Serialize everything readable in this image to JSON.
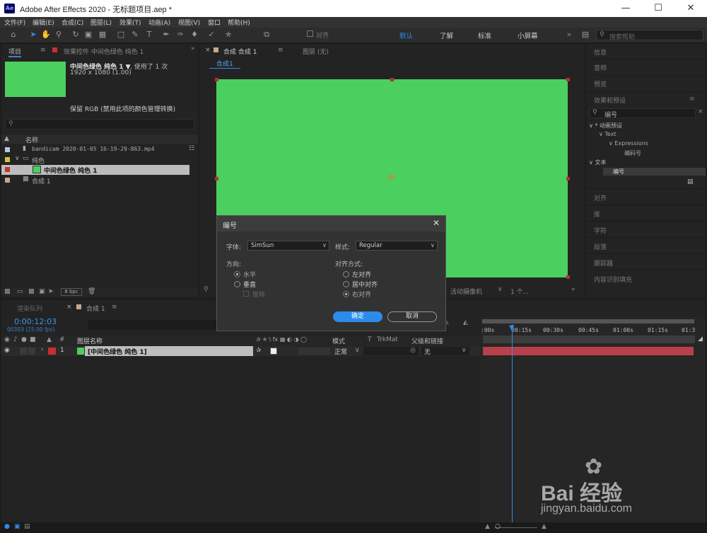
{
  "titlebar": {
    "icon": "Ae",
    "title": "Adobe After Effects 2020 - 无标题项目.aep *"
  },
  "menu": [
    "文件(F)",
    "编辑(E)",
    "合成(C)",
    "图层(L)",
    "效果(T)",
    "动画(A)",
    "视图(V)",
    "窗口",
    "帮助(H)"
  ],
  "toolbar": {
    "align_label": "对齐",
    "workspaces": [
      "默认",
      "了解",
      "标准",
      "小屏幕"
    ],
    "search_placeholder": "搜索帮助"
  },
  "project_panel": {
    "tab_project": "项目",
    "tab_effects": "效果控件 中间色绿色 纯色 1",
    "thumb_name": "中间色绿色 纯色 1 ▼",
    "used_times": ", 使用了 1 次",
    "dims": "1920 x 1080 (1.00)",
    "color_note": "保留 RGB (禁用此项的颜色管理转换)",
    "col_name": "名称",
    "items": [
      {
        "name": "bandicam 2020-01-05 16-19-29-863.mp4",
        "label_color": "#b4c8dc"
      },
      {
        "name": "纯色",
        "label_color": "#d8c038"
      },
      {
        "name": "中间色绿色 纯色 1",
        "label_color": "#c83030"
      },
      {
        "name": "合成 1",
        "label_color": "#c8a888"
      }
    ],
    "bpc": "8 bpc"
  },
  "comp_panel": {
    "tab_comp": "合成 合成 1",
    "tab_layer": "图层 (无)",
    "breadcrumb": "合成1",
    "solid_color": "#4bcf5f",
    "bottom_camera": "活动摄像机",
    "bottom_views": "1 个..."
  },
  "right_panel": {
    "items_top": [
      "信息",
      "音频",
      "预览"
    ],
    "effects_title": "效果和预设",
    "search_value": "编号",
    "tree": [
      "∨ * 动画预设",
      "∨ Text",
      "∨ Expressions",
      "编码号",
      "∨ 文本",
      "编号"
    ],
    "items_bottom": [
      "对齐",
      "库",
      "字符",
      "段落",
      "跟踪器",
      "内容识别填充"
    ]
  },
  "dialog": {
    "title": "编号",
    "font_label": "字体:",
    "font_value": "SimSun",
    "style_label": "样式:",
    "style_value": "Regular",
    "direction_label": "方向:",
    "horizontal": "水平",
    "vertical": "垂直",
    "rotate": "旋转",
    "align_label": "对齐方式:",
    "align_left": "左对齐",
    "align_center": "居中对齐",
    "align_right": "右对齐",
    "ok": "确定",
    "cancel": "取消"
  },
  "timeline": {
    "tab_render": "渲染队列",
    "tab_comp": "合成 1",
    "timecode": "0:00:12:03",
    "frames": "00303 (25.00 fps)",
    "col_num": "#",
    "col_layer_name": "图层名称",
    "col_mode": "模式",
    "col_t": "T",
    "col_trkmat": "TrkMat",
    "col_parent": "父级和链接",
    "layer": {
      "num": "1",
      "name": "[中间色绿色 纯色 1]",
      "mode": "正常",
      "parent": "无",
      "label_color": "#c83030",
      "bar_color": "#b8404a"
    },
    "ruler": [
      ":00s",
      "00:15s",
      "00:30s",
      "00:45s",
      "01:00s",
      "01:15s",
      "01:3"
    ],
    "playhead": "00:12:03"
  },
  "watermark": {
    "brand": "Bai  经验",
    "url": "jingyan.baidu.com"
  }
}
